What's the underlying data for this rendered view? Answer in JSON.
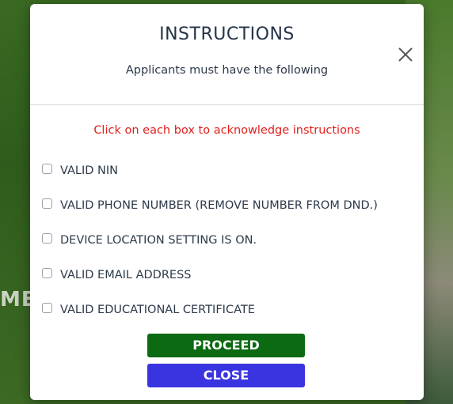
{
  "background": {
    "partial_text": "ME"
  },
  "modal": {
    "title": "INSTRUCTIONS",
    "subtitle": "Applicants must have the following",
    "notice": "Click on each box to acknowledge instructions",
    "checklist": [
      {
        "label": "VALID NIN",
        "checked": false
      },
      {
        "label": "VALID PHONE NUMBER (REMOVE NUMBER FROM DND.)",
        "checked": false
      },
      {
        "label": "DEVICE LOCATION SETTING IS ON.",
        "checked": false
      },
      {
        "label": "VALID EMAIL ADDRESS",
        "checked": false
      },
      {
        "label": "VALID EDUCATIONAL CERTIFICATE",
        "checked": false
      }
    ],
    "proceed_label": "PROCEED",
    "close_label": "CLOSE"
  },
  "colors": {
    "notice": "#e0201c",
    "proceed_button": "#0c6a12",
    "close_button": "#3a34e0"
  },
  "icons": {
    "close": "close-icon"
  }
}
